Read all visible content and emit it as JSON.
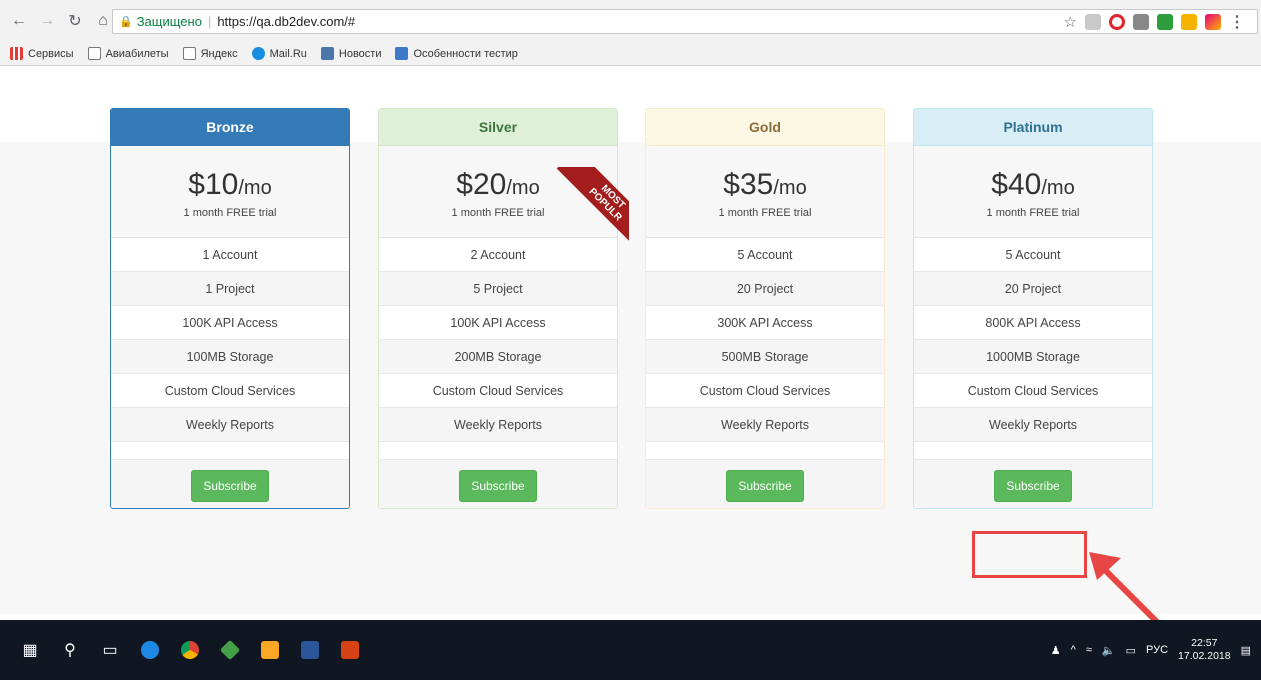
{
  "browser": {
    "secure_label": "Защищено",
    "url": "https://qa.db2dev.com/#"
  },
  "bookmarks": [
    {
      "label": "Сервисы",
      "icon": "apps-grid-icon"
    },
    {
      "label": "Авиабилеты",
      "icon": "page-icon"
    },
    {
      "label": "Яндекс",
      "icon": "page-icon"
    },
    {
      "label": "Mail.Ru",
      "icon": "mailru-icon"
    },
    {
      "label": "Новости",
      "icon": "vk-icon"
    },
    {
      "label": "Особенности тестир",
      "icon": "doc-icon"
    }
  ],
  "plans": [
    {
      "name": "Bronze",
      "price": "$10",
      "per": "/mo",
      "trial": "1 month FREE trial",
      "features": [
        "1 Account",
        "1 Project",
        "100K API Access",
        "100MB Storage",
        "Custom Cloud Services",
        "Weekly Reports"
      ],
      "button": "Subscribe"
    },
    {
      "name": "Silver",
      "price": "$20",
      "per": "/mo",
      "trial": "1 month FREE trial",
      "features": [
        "2 Account",
        "5 Project",
        "100K API Access",
        "200MB Storage",
        "Custom Cloud Services",
        "Weekly Reports"
      ],
      "button": "Subscribe"
    },
    {
      "name": "Gold",
      "price": "$35",
      "per": "/mo",
      "trial": "1 month FREE trial",
      "features": [
        "5 Account",
        "20 Project",
        "300K API Access",
        "500MB Storage",
        "Custom Cloud Services",
        "Weekly Reports"
      ],
      "button": "Subscribe"
    },
    {
      "name": "Platinum",
      "price": "$40",
      "per": "/mo",
      "trial": "1 month FREE trial",
      "features": [
        "5 Account",
        "20 Project",
        "800K API Access",
        "1000MB Storage",
        "Custom Cloud Services",
        "Weekly Reports"
      ],
      "button": "Subscribe"
    }
  ],
  "ribbon": {
    "line1": "MOST",
    "line2": "POPULR"
  },
  "taskbar": {
    "lang": "РУС",
    "time": "22:57",
    "date": "17.02.2018"
  },
  "colors": {
    "subscribe": "#5cb85c",
    "bronze_header": "#337ab7",
    "ribbon": "#a31d1d",
    "annotation": "#e84545"
  }
}
